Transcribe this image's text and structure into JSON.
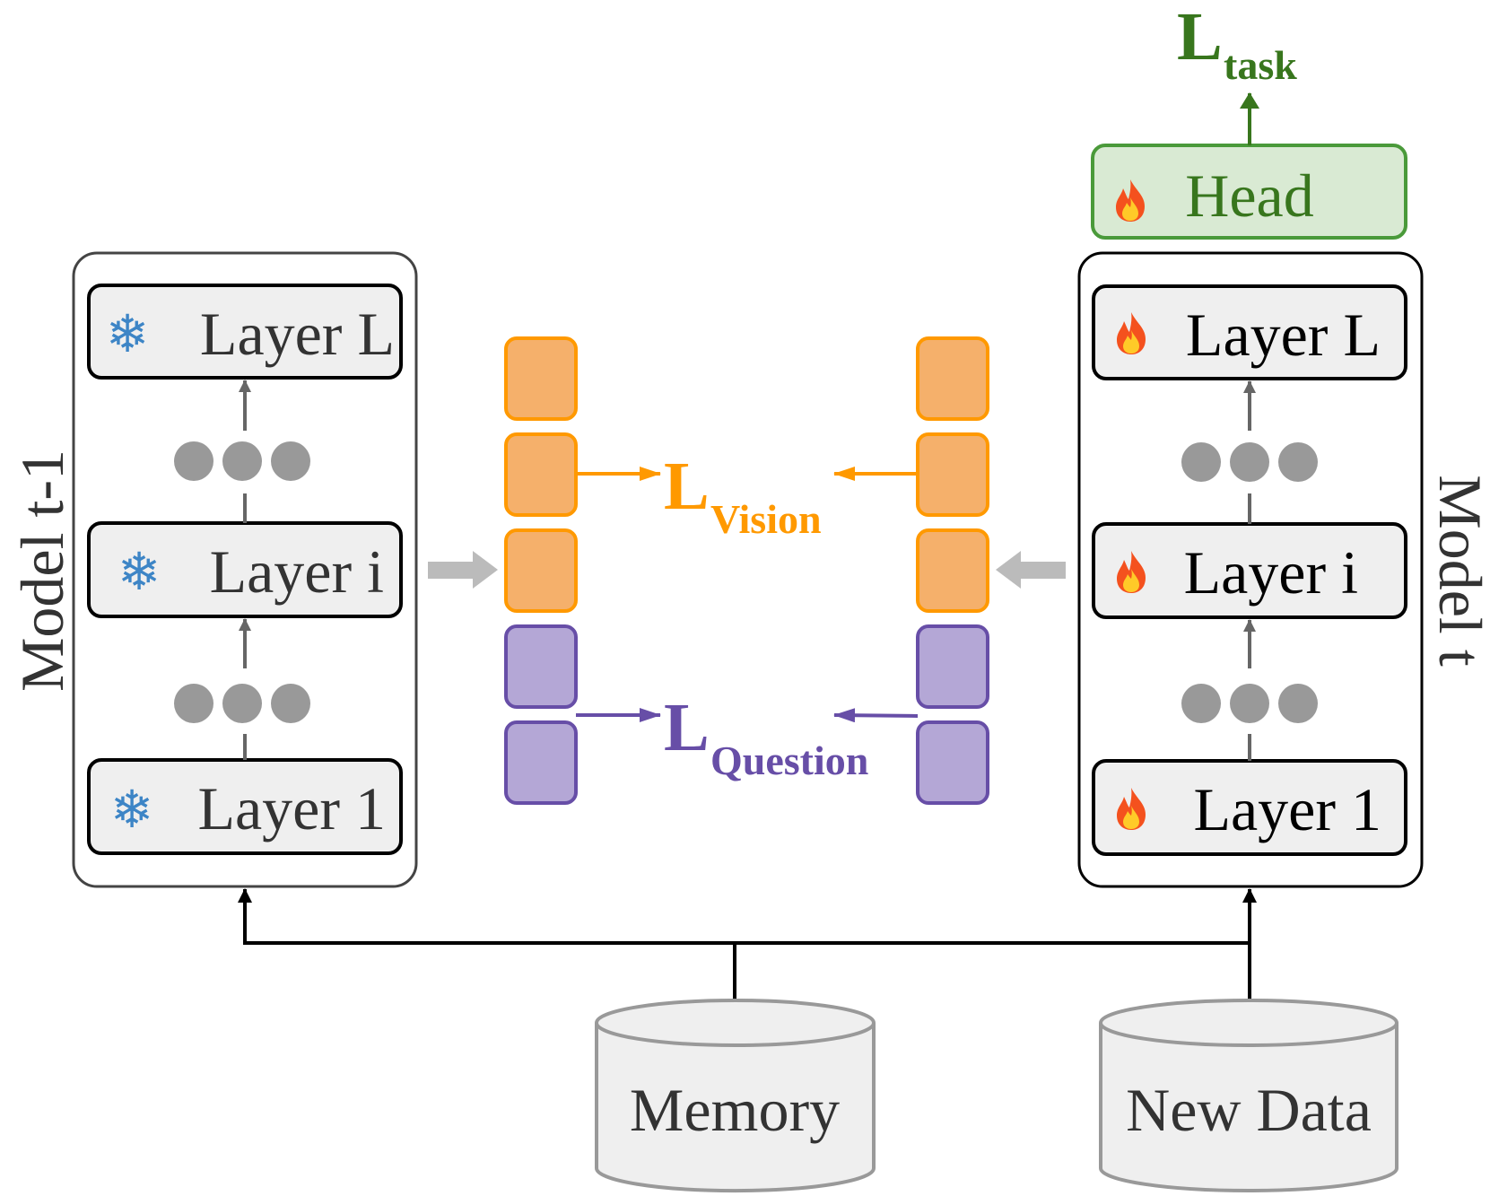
{
  "model_prev": {
    "title": "Model t-1",
    "layers": [
      {
        "label": "Layer L",
        "icon": "snowflake-icon"
      },
      {
        "label": "Layer i",
        "icon": "snowflake-icon"
      },
      {
        "label": "Layer 1",
        "icon": "snowflake-icon"
      }
    ]
  },
  "model_cur": {
    "title": "Model t",
    "head": {
      "label": "Head",
      "icon": "fire-icon"
    },
    "layers": [
      {
        "label": "Layer L",
        "icon": "fire-icon"
      },
      {
        "label": "Layer i",
        "icon": "fire-icon"
      },
      {
        "label": "Layer 1",
        "icon": "fire-icon"
      }
    ]
  },
  "losses": {
    "task": {
      "main": "L",
      "sub": "task"
    },
    "vision": {
      "main": "L",
      "sub": "Vision"
    },
    "question": {
      "main": "L",
      "sub": "Question"
    }
  },
  "data_sources": {
    "memory": "Memory",
    "new_data": "New Data"
  },
  "colors": {
    "orange": "#f5b06b",
    "orange_stroke": "#ff9900",
    "purple": "#b4a7d6",
    "purple_stroke": "#674ea7",
    "green_fill": "#d9ead3",
    "green": "#38761d",
    "snowflake": "#3d85c6",
    "layer_fill": "#efefef"
  }
}
